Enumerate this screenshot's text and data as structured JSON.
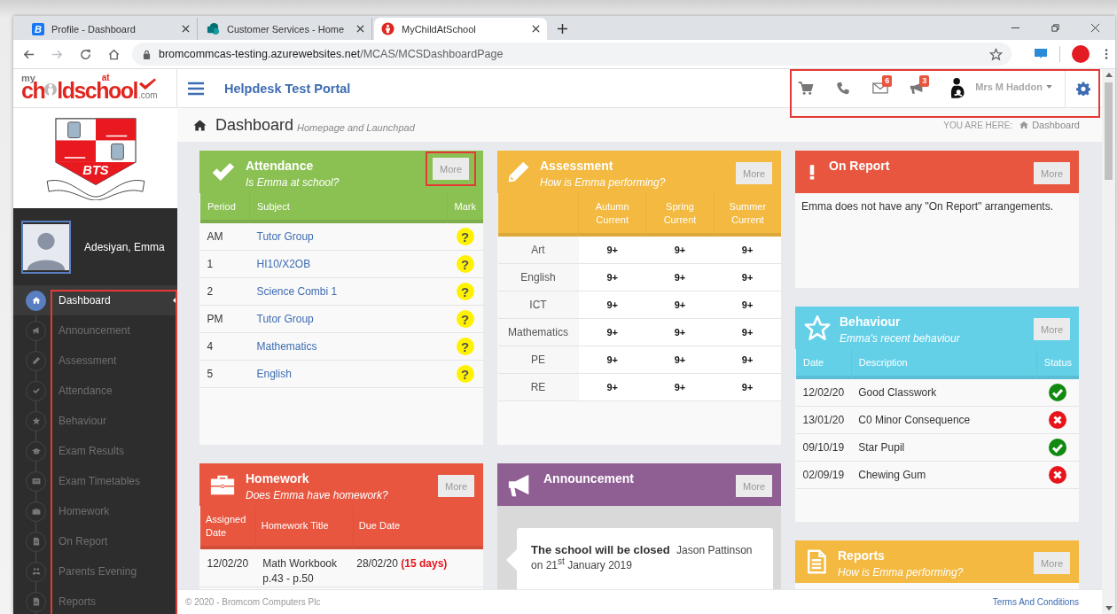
{
  "browser": {
    "tabs": [
      {
        "kind": "bromcom",
        "icon_letter": "B",
        "title": "Profile - Dashboard",
        "selected": false
      },
      {
        "kind": "sharepoint",
        "title": "Customer Services - Home",
        "selected": false
      },
      {
        "kind": "mcas",
        "title": "MyChildAtSchool",
        "selected": true
      }
    ],
    "address": {
      "host": "bromcommcas-testing.azurewebsites.net",
      "path": "/MCAS/MCSDashboardPage"
    }
  },
  "logo": {
    "my": "my",
    "ch": "ch",
    "ld": "ld",
    "at": "at",
    "school": "school",
    "com": ".com"
  },
  "portal_title": "Helpdesk Test Portal",
  "toolbar": {
    "mail_badge": "6",
    "announcement_badge": "3",
    "user": "Mrs M Haddon"
  },
  "crest": {
    "initials": "BTS"
  },
  "student": {
    "name": "Adesiyan, Emma"
  },
  "nav": [
    {
      "label": "Dashboard",
      "selected": true
    },
    {
      "label": "Announcement",
      "selected": false
    },
    {
      "label": "Assessment",
      "selected": false
    },
    {
      "label": "Attendance",
      "selected": false
    },
    {
      "label": "Behaviour",
      "selected": false
    },
    {
      "label": "Exam Results",
      "selected": false
    },
    {
      "label": "Exam Timetables",
      "selected": false
    },
    {
      "label": "Homework",
      "selected": false
    },
    {
      "label": "On Report",
      "selected": false
    },
    {
      "label": "Parents Evening",
      "selected": false
    },
    {
      "label": "Reports",
      "selected": false
    }
  ],
  "breadcrumb": {
    "title": "Dashboard",
    "subtitle": "Homepage and Launchpad",
    "you_are_here": "YOU ARE HERE:",
    "current": "Dashboard"
  },
  "columns": [
    {
      "cards": [
        {
          "kind": "attendance",
          "title": "Attendance",
          "subtitle": "Is Emma at school?",
          "more": "More",
          "highlighted": true,
          "color": "#8bc052",
          "columns": [
            "Period",
            "Subject",
            "Mark"
          ],
          "rows": [
            {
              "period": "AM",
              "subject": "Tutor Group",
              "mark": "?"
            },
            {
              "period": "1",
              "subject": "HI10/X2OB",
              "mark": "?"
            },
            {
              "period": "2",
              "subject": "Science Combi 1",
              "mark": "?"
            },
            {
              "period": "PM",
              "subject": "Tutor Group",
              "mark": "?"
            },
            {
              "period": "4",
              "subject": "Mathematics",
              "mark": "?"
            },
            {
              "period": "5",
              "subject": "English",
              "mark": "?"
            }
          ]
        },
        {
          "kind": "homework",
          "title": "Homework",
          "subtitle": "Does Emma have homework?",
          "more": "More",
          "highlighted": false,
          "color": "#e8563f",
          "columns": [
            "Assigned Date",
            "Homework Title",
            "Due Date"
          ],
          "rows": [
            {
              "assigned": "12/02/20",
              "title": "Math Workbook p.43 - p.50",
              "due": "28/02/20",
              "remaining": "(15 days)"
            }
          ]
        }
      ]
    },
    {
      "cards": [
        {
          "kind": "assessment",
          "title": "Assessment",
          "subtitle": "How is Emma performing?",
          "more": "More",
          "highlighted": false,
          "color": "#f3b940",
          "columns": [
            "Autumn Current",
            "Spring Current",
            "Summer Current"
          ],
          "rows": [
            {
              "subject": "Art",
              "grades": [
                "9+",
                "9+",
                "9+"
              ]
            },
            {
              "subject": "English",
              "grades": [
                "9+",
                "9+",
                "9+"
              ]
            },
            {
              "subject": "ICT",
              "grades": [
                "9+",
                "9+",
                "9+"
              ]
            },
            {
              "subject": "Mathematics",
              "grades": [
                "9+",
                "9+",
                "9+"
              ]
            },
            {
              "subject": "PE",
              "grades": [
                "9+",
                "9+",
                "9+"
              ]
            },
            {
              "subject": "RE",
              "grades": [
                "9+",
                "9+",
                "9+"
              ]
            }
          ]
        },
        {
          "kind": "announcement",
          "title": "Announcement",
          "more": "More",
          "highlighted": false,
          "color": "#8f5e93",
          "items": [
            {
              "title": "The school will be closed",
              "author": "Jason Pattinson",
              "date": "on 21$^{st}$ January 2019"
            }
          ]
        }
      ]
    },
    {
      "cards": [
        {
          "kind": "on_report",
          "title": "On Report",
          "more": "More",
          "highlighted": false,
          "color": "#e8563f",
          "message": "Emma does not have any \"On Report\" arrangements."
        },
        {
          "kind": "behaviour",
          "title": "Behaviour",
          "subtitle": "Emma's recent behaviour",
          "more": "More",
          "highlighted": false,
          "color": "#63d0e8",
          "columns": [
            "Date",
            "Description",
            "Status"
          ],
          "rows": [
            {
              "date": "12/02/20",
              "description": "Good Classwork",
              "kind": "positive"
            },
            {
              "date": "13/01/20",
              "description": "C0 Minor Consequence",
              "kind": "negative"
            },
            {
              "date": "09/10/19",
              "description": "Star Pupil",
              "kind": "positive"
            },
            {
              "date": "02/09/19",
              "description": "Chewing Gum",
              "kind": "negative"
            }
          ]
        },
        {
          "kind": "reports",
          "title": "Reports",
          "subtitle": "How is Emma performing?",
          "more": "More",
          "highlighted": false,
          "color": "#f3b940"
        }
      ]
    }
  ],
  "footer": {
    "copyright": "© 2020 - Bromcom Computers Plc",
    "terms": "Terms And Conditions"
  }
}
